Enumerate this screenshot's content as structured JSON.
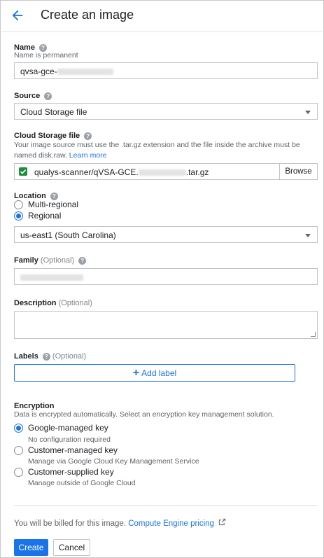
{
  "header": {
    "title": "Create an image",
    "back_icon": "arrow-left-icon"
  },
  "name": {
    "label": "Name",
    "hint": "Name is permanent",
    "value_prefix": "qvsa-gce-"
  },
  "source": {
    "label": "Source",
    "selected": "Cloud Storage file"
  },
  "cloud_storage": {
    "label": "Cloud Storage file",
    "hint_text": "Your image source must use the .tar.gz extension and the file inside the archive must be named disk.raw.",
    "learn_more": "Learn more",
    "path_prefix": "qualys-scanner/qVSA-GCE.",
    "path_suffix": ".tar.gz",
    "browse_label": "Browse"
  },
  "location": {
    "label": "Location",
    "options": [
      "Multi-regional",
      "Regional"
    ],
    "selected_option": "Regional",
    "region_selected": "us-east1 (South Carolina)"
  },
  "family": {
    "label": "Family",
    "optional": "(Optional)"
  },
  "description": {
    "label": "Description",
    "optional": "(Optional)"
  },
  "labels": {
    "label": "Labels",
    "optional": "(Optional)",
    "add_label": "Add label"
  },
  "encryption": {
    "label": "Encryption",
    "hint": "Data is encrypted automatically. Select an encryption key management solution.",
    "options": [
      {
        "title": "Google-managed key",
        "desc": "No configuration required"
      },
      {
        "title": "Customer-managed key",
        "desc": "Manage via Google Cloud Key Management Service"
      },
      {
        "title": "Customer-supplied key",
        "desc": "Manage outside of Google Cloud"
      }
    ],
    "selected_option": "Google-managed key"
  },
  "billing": {
    "text": "You will be billed for this image.",
    "link": "Compute Engine pricing"
  },
  "actions": {
    "create": "Create",
    "cancel": "Cancel"
  },
  "colors": {
    "accent": "#1a73e8",
    "checkbox": "#1e8e3e"
  }
}
